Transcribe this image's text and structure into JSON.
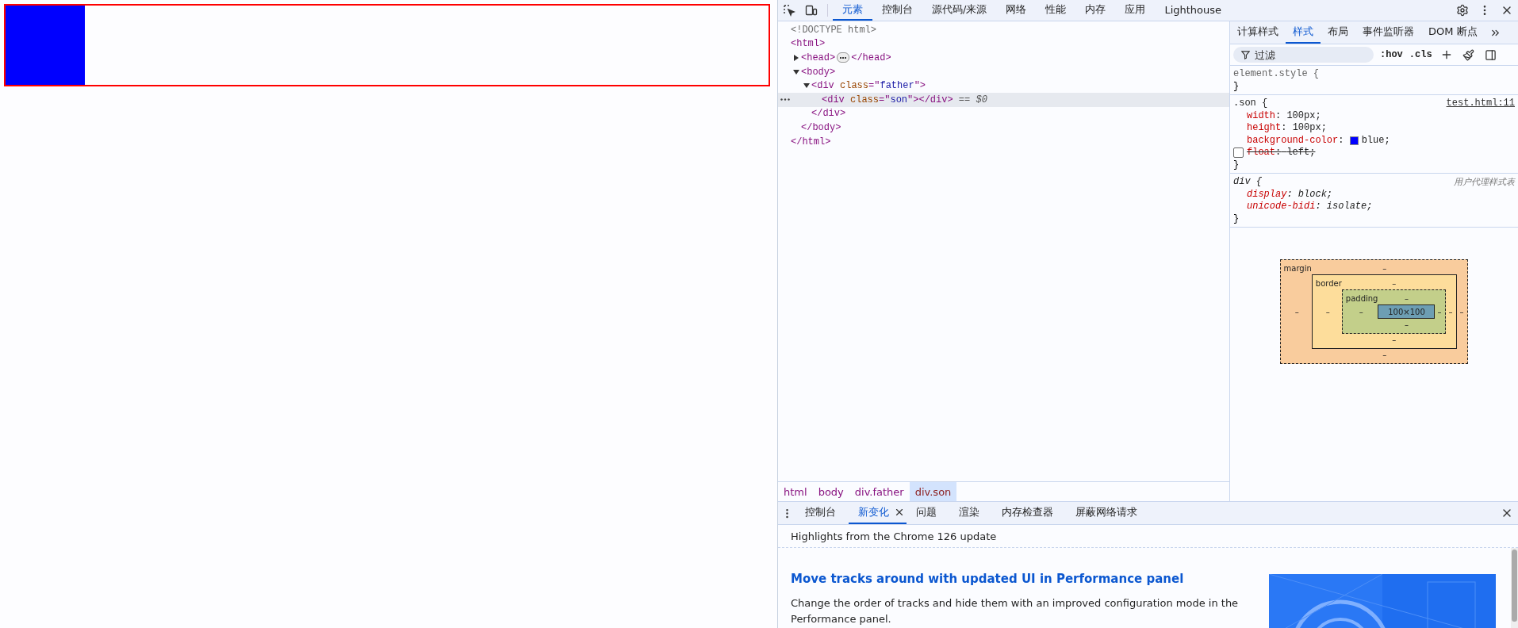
{
  "viewport": {
    "son": {
      "color": "#0000ff"
    },
    "father": {
      "color": "#ff0000"
    }
  },
  "main_tabs": [
    {
      "label": "元素",
      "selected": true
    },
    {
      "label": "控制台",
      "selected": false
    },
    {
      "label": "源代码/来源",
      "selected": false
    },
    {
      "label": "网络",
      "selected": false
    },
    {
      "label": "性能",
      "selected": false
    },
    {
      "label": "内存",
      "selected": false
    },
    {
      "label": "应用",
      "selected": false
    },
    {
      "label": "Lighthouse",
      "selected": false
    }
  ],
  "dom_tree": [
    {
      "tokens": [
        {
          "kind": "doctype",
          "text": "<!DOCTYPE html>"
        }
      ],
      "selected": false
    },
    {
      "tokens": [
        {
          "kind": "tag",
          "text": "<html>"
        }
      ],
      "selected": false,
      "close": [
        {
          "kind": "tag",
          "text": "</html>"
        }
      ],
      "children": [
        {
          "tokens": [
            {
              "kind": "tag",
              "text": "<head>"
            },
            {
              "kind": "ellipsis"
            },
            {
              "kind": "tag",
              "text": "</head>"
            }
          ],
          "expanded": false,
          "selected": false
        },
        {
          "tokens": [
            {
              "kind": "tag",
              "text": "<body>"
            }
          ],
          "expanded": true,
          "selected": false,
          "close": [
            {
              "kind": "tag",
              "text": "</body>"
            }
          ],
          "children": [
            {
              "tokens": [
                {
                  "kind": "tag",
                  "text": "<div "
                },
                {
                  "kind": "attr",
                  "text": "class"
                },
                {
                  "kind": "tag",
                  "text": "=\""
                },
                {
                  "kind": "value",
                  "text": "father"
                },
                {
                  "kind": "tag",
                  "text": "\">"
                }
              ],
              "expanded": true,
              "selected": false,
              "close": [
                {
                  "kind": "tag",
                  "text": "</div>"
                }
              ],
              "children": [
                {
                  "tokens": [
                    {
                      "kind": "tag",
                      "text": "<div "
                    },
                    {
                      "kind": "attr",
                      "text": "class"
                    },
                    {
                      "kind": "tag",
                      "text": "=\""
                    },
                    {
                      "kind": "value",
                      "text": "son"
                    },
                    {
                      "kind": "tag",
                      "text": "\"></div>"
                    },
                    {
                      "kind": "plain",
                      "text": " == "
                    },
                    {
                      "kind": "ref",
                      "text": "$0"
                    }
                  ],
                  "selected": true
                }
              ]
            }
          ]
        }
      ]
    }
  ],
  "breadcrumbs": [
    {
      "label": "html",
      "selected": false
    },
    {
      "label": "body",
      "selected": false
    },
    {
      "label": "div.father",
      "selected": false
    },
    {
      "label": "div.son",
      "selected": true
    }
  ],
  "sidebar_tabs": [
    {
      "label": "计算样式",
      "selected": false
    },
    {
      "label": "样式",
      "selected": true
    },
    {
      "label": "布局",
      "selected": false
    },
    {
      "label": "事件监听器",
      "selected": false
    },
    {
      "label": "DOM 断点",
      "selected": false
    }
  ],
  "filter": {
    "placeholder": "过滤"
  },
  "style_tools": [
    ":hov",
    ".cls"
  ],
  "rules": [
    {
      "selector": "element.style {",
      "user_agent": false,
      "inline": true,
      "end": "}"
    },
    {
      "selector": ".son {",
      "source": "test.html:11",
      "user_agent": false,
      "inline": false,
      "end": "}",
      "properties": [
        {
          "name": "width",
          "sep": ":",
          "value": "100px;",
          "enabled": true
        },
        {
          "name": "height",
          "sep": ":",
          "value": "100px;",
          "enabled": true
        },
        {
          "name": "background-color",
          "sep": ":",
          "value": "blue;",
          "enabled": true,
          "color": "#0000ff"
        },
        {
          "name": "float",
          "sep": ":",
          "value": "left;",
          "enabled": false
        }
      ]
    },
    {
      "selector": "div {",
      "source": "用户代理样式表",
      "user_agent": true,
      "inline": false,
      "end": "}",
      "properties": [
        {
          "name": "display",
          "sep": ":",
          "value": "block;",
          "enabled": true
        },
        {
          "name": "unicode-bidi",
          "sep": ":",
          "value": "isolate;",
          "enabled": true
        }
      ]
    }
  ],
  "box_model": {
    "margin": {
      "label": "margin",
      "top": "–",
      "right": "–",
      "bottom": "–",
      "left": "–"
    },
    "border": {
      "label": "border",
      "top": "–",
      "right": "–",
      "bottom": "–",
      "left": "–"
    },
    "padding": {
      "label": "padding",
      "top": "–",
      "right": "–",
      "bottom": "–",
      "left": "–"
    },
    "content": "100×100"
  },
  "drawer_tabs": [
    {
      "label": "控制台",
      "selected": false,
      "closable": false
    },
    {
      "label": "新变化",
      "selected": true,
      "closable": true
    },
    {
      "label": "问题",
      "selected": false,
      "closable": false
    },
    {
      "label": "渲染",
      "selected": false,
      "closable": false
    },
    {
      "label": "内存检查器",
      "selected": false,
      "closable": false
    },
    {
      "label": "屏蔽网络请求",
      "selected": false,
      "closable": false
    }
  ],
  "whats_new": {
    "header": "Highlights from the Chrome 126 update",
    "title": "Move tracks around with updated UI in Performance panel",
    "body": "Change the order of tracks and hide them with an improved configuration mode in the Performance panel."
  }
}
